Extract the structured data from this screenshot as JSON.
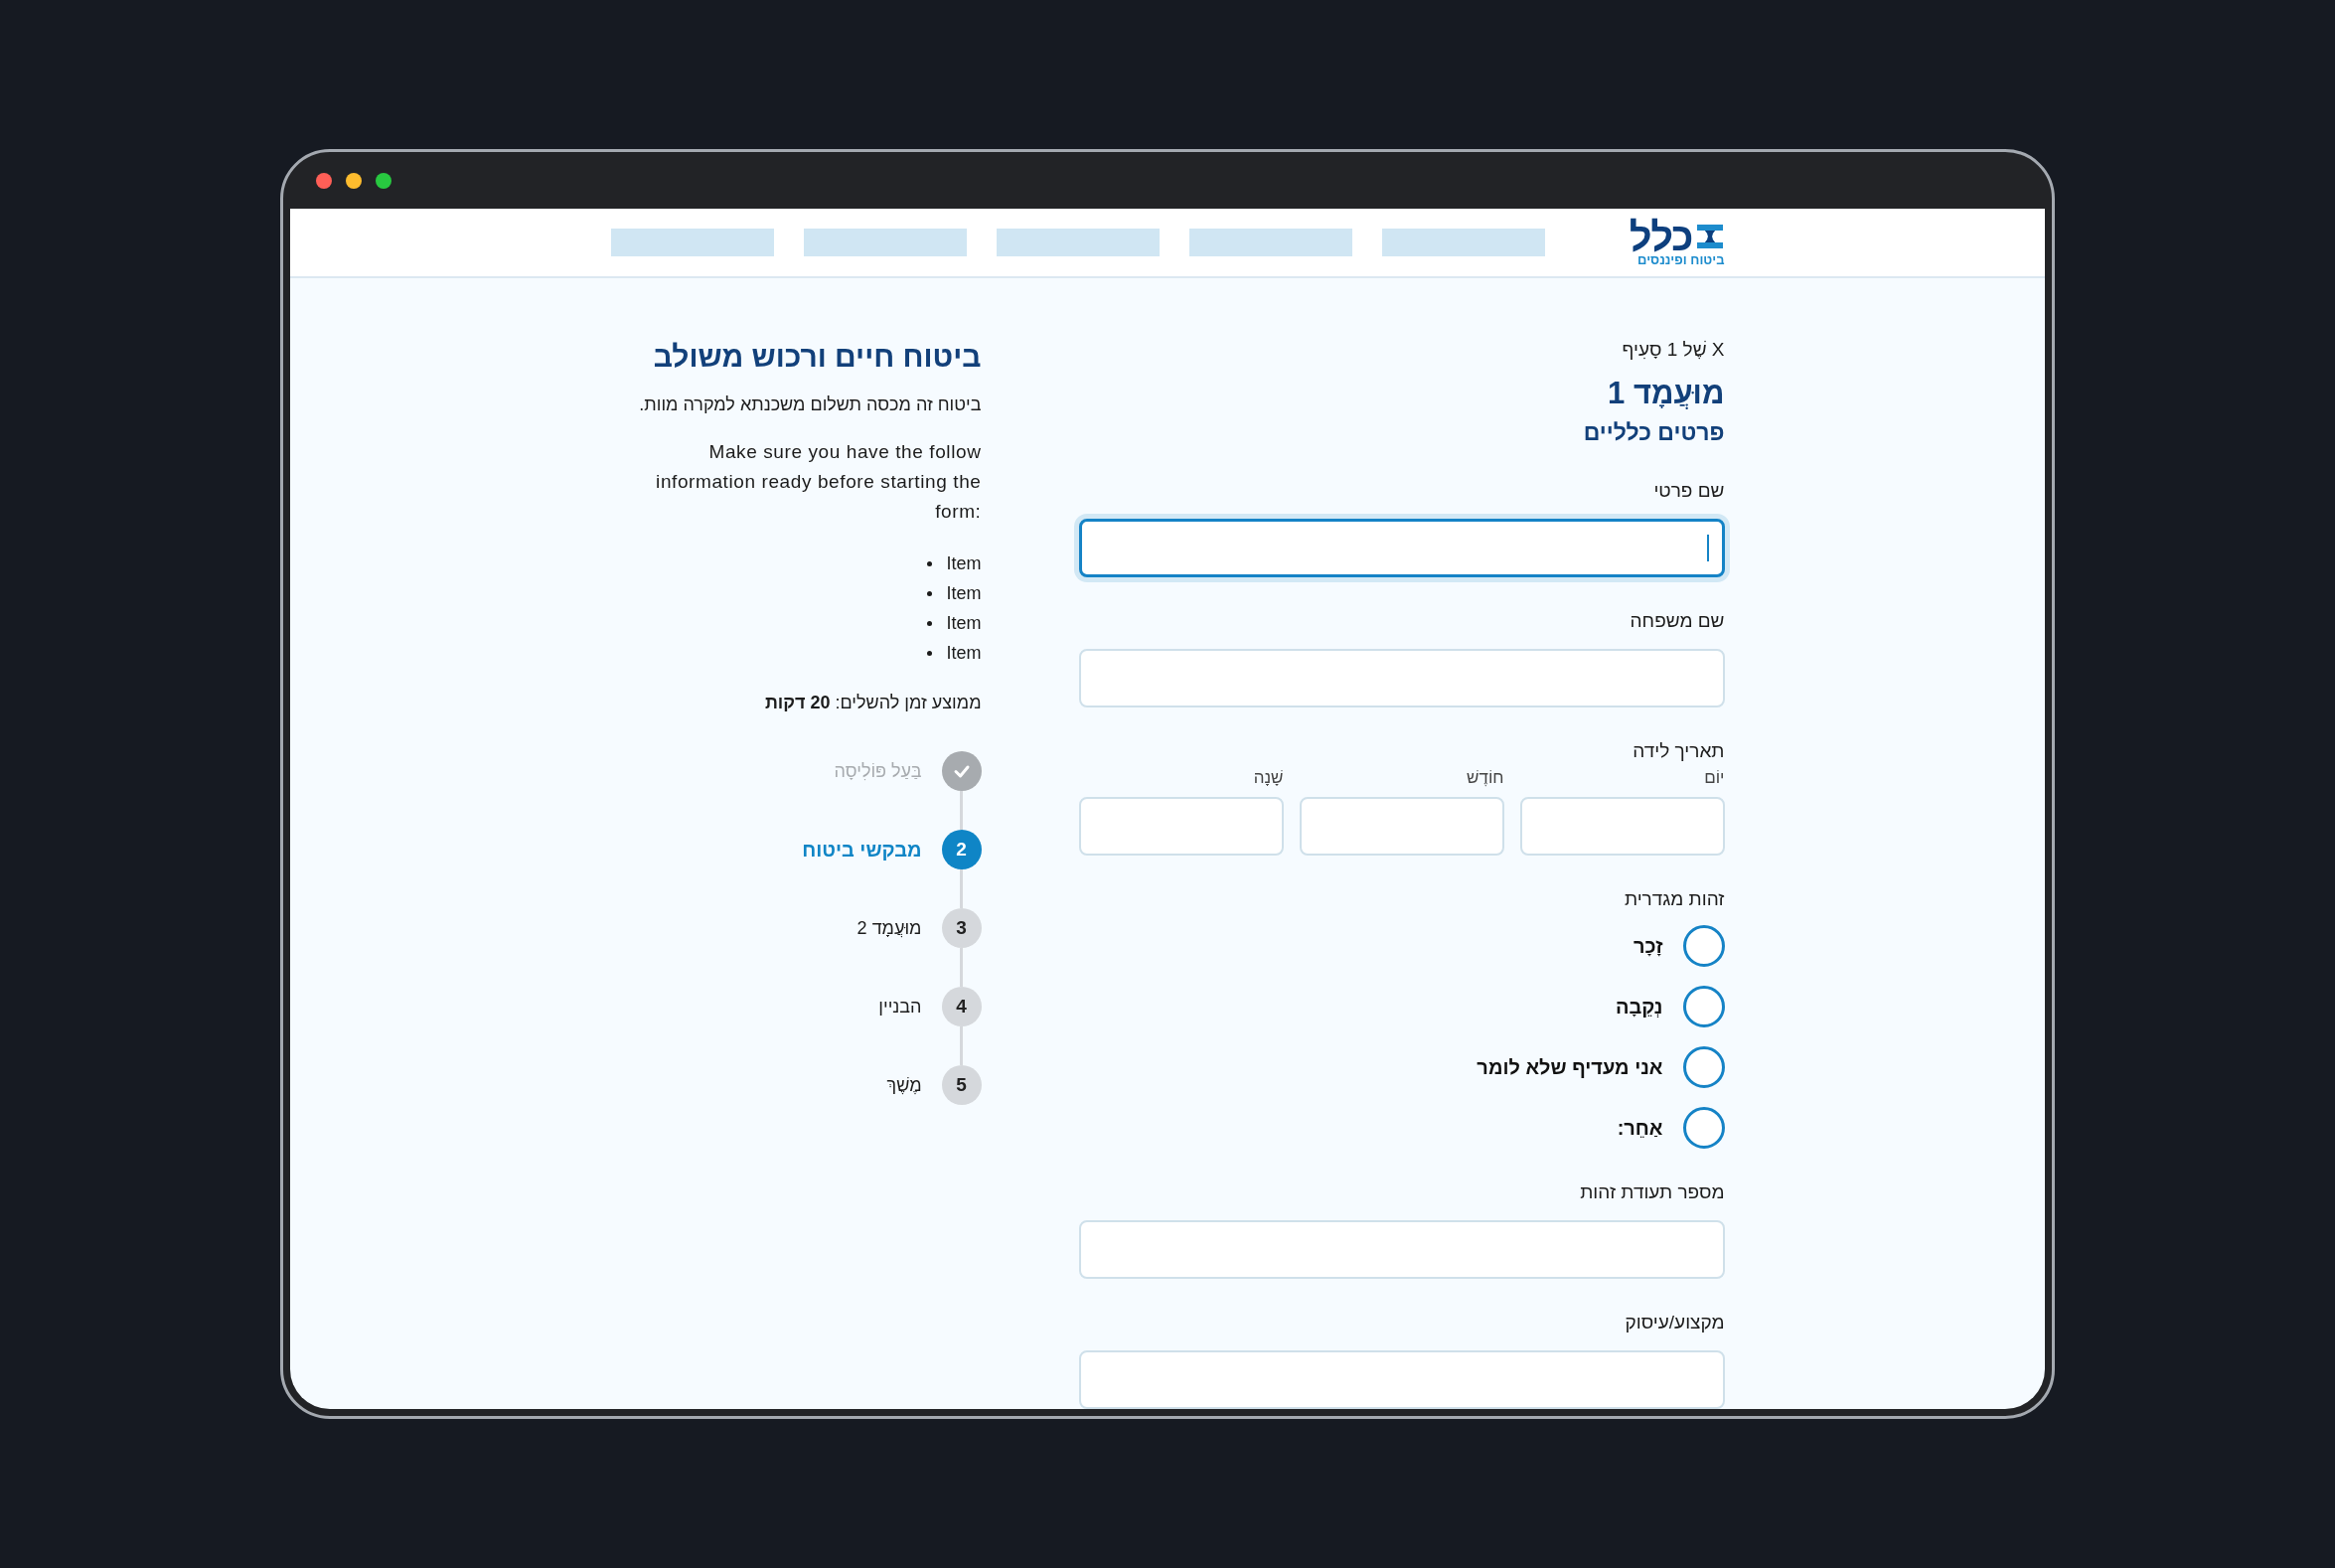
{
  "window": {
    "controls": [
      {
        "color": "#ff5f57"
      },
      {
        "color": "#febc2e"
      },
      {
        "color": "#28c840"
      }
    ]
  },
  "header": {
    "logo": {
      "name": "כלל",
      "tagline": "ביטוח ופיננסים"
    }
  },
  "intro": {
    "title": "ביטוח חיים ורכוש משולב",
    "description": "ביטוח זה מכסה תשלום משכנתא למקרה מוות.",
    "instructions": "Make sure you have the follow information ready before starting the form:",
    "items": [
      "Item",
      "Item",
      "Item",
      "Item"
    ],
    "average_time": "ממוצע זמן להשלים:  **20 דקות**"
  },
  "steps": [
    {
      "label": "בַּעַל פּוֹלִיסָה",
      "completed": true,
      "selected": false
    },
    {
      "number": "2",
      "label": "מבקשי ביטוח",
      "completed": false,
      "selected": true
    },
    {
      "number": "3",
      "label": "מוּעֲמָד 2",
      "completed": false,
      "selected": false
    },
    {
      "number": "4",
      "label": "הבניין",
      "completed": false,
      "selected": false
    },
    {
      "number": "5",
      "label": "מֶשֶׁךְ",
      "completed": false,
      "selected": false
    }
  ],
  "form": {
    "section_counter": "X שֶׁל 1 סָעִיף",
    "title": "מוּעֲמָד 1",
    "subtitle": "פרטים כלליים",
    "fields": [
      {
        "kind": "text",
        "label": "שם פרטי",
        "focused": true
      },
      {
        "kind": "text",
        "label": "שם משפחה",
        "focused": false
      },
      {
        "kind": "date",
        "label": "תאריך לידה",
        "parts": [
          "יוֹם",
          "חוֹדֶשׁ",
          "שָׁנָה"
        ]
      },
      {
        "kind": "radio",
        "label": "זהות מגדרית",
        "options": [
          {
            "label": "זָכָר",
            "selected": false
          },
          {
            "label": "נְקֵבָה",
            "selected": false
          },
          {
            "label": "אני מעדיף שלא לומר",
            "selected": false
          },
          {
            "label": "אַחֵר:",
            "selected": false
          }
        ]
      },
      {
        "kind": "text",
        "label": "מספר תעודת זהות",
        "focused": false
      },
      {
        "kind": "text",
        "label": "מקצוע/עיסוק",
        "focused": false
      }
    ]
  }
}
